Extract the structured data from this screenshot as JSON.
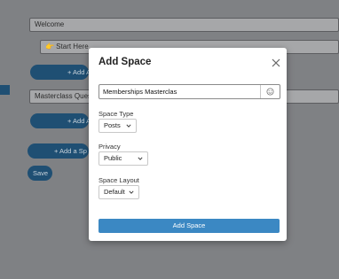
{
  "background": {
    "welcome_field": "Welcome",
    "start_here_field": "👉 Start Here",
    "add_button_1": "+ Add A",
    "masterclass_field": "Masterclass Questi",
    "add_button_2": "+ Add A",
    "add_space_button": "+ Add a Sp",
    "save_button": "Save"
  },
  "modal": {
    "title": "Add Space",
    "name_value": "Memberships Masterclas",
    "space_type_label": "Space Type",
    "space_type_value": "Posts",
    "privacy_label": "Privacy",
    "privacy_value": "Public",
    "layout_label": "Space Layout",
    "layout_value": "Default",
    "submit_label": "Add Space"
  },
  "colors": {
    "accent": "#3b88c3",
    "overlay": "#7f8184"
  }
}
